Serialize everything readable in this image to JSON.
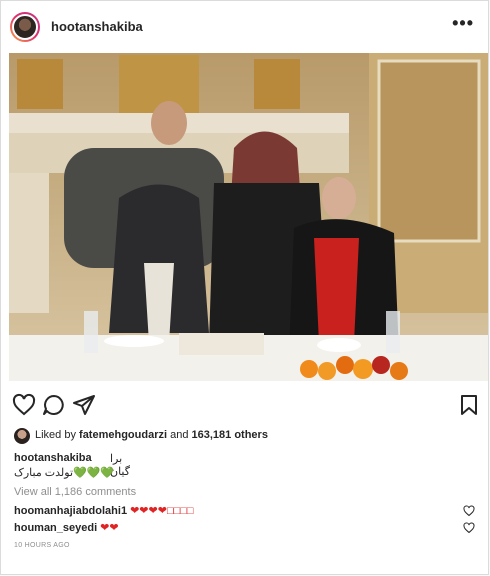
{
  "post": {
    "username": "hootanshakiba",
    "more_icon": "•••"
  },
  "actions": {
    "like_icon": "heart-outline-icon",
    "comment_icon": "comment-icon",
    "share_icon": "paper-plane-icon",
    "save_icon": "bookmark-icon"
  },
  "likes": {
    "prefix": "Liked by ",
    "user": "fatemehgoudarzi",
    "middle": " and ",
    "count": "163,181 others"
  },
  "caption": {
    "user": "hootanshakiba",
    "line1": "برا گیان",
    "line2_text": "تولدت مبارک",
    "line2_hearts": "💚💚💚"
  },
  "view_comments": "View all 1,186 comments",
  "comments": [
    {
      "user": "hoomanhajiabdolahi1",
      "text": "❤❤❤❤□□□□"
    },
    {
      "user": "houman_seyedi",
      "text": "❤❤"
    }
  ],
  "timestamp": "10 HOURS AGO",
  "colors": {
    "border": "#dbdbdb",
    "muted": "#8e8e8e",
    "heart_red": "#e02424",
    "heart_green": "#2fb52f"
  }
}
